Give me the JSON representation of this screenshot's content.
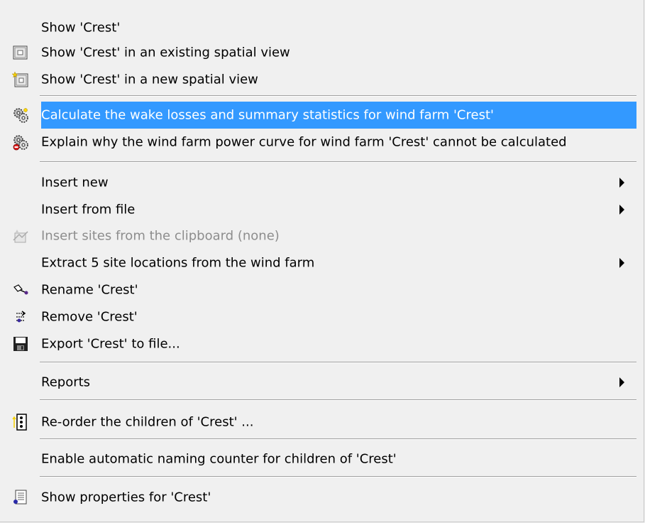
{
  "menu": {
    "items": [
      {
        "label": "Show 'Crest'"
      },
      {
        "label": "Show 'Crest' in an existing spatial view",
        "icon": "spatial-view-icon"
      },
      {
        "label": "Show 'Crest' in a new spatial view",
        "icon": "new-spatial-view-icon"
      },
      {
        "label": "Calculate the wake losses and summary statistics for wind farm 'Crest'",
        "icon": "calculate-gears-icon",
        "highlighted": true
      },
      {
        "label": "Explain why the wind farm power curve for wind farm 'Crest' cannot be calculated",
        "icon": "explain-gears-icon"
      },
      {
        "label": "Insert new",
        "submenu": true
      },
      {
        "label": "Insert from file",
        "submenu": true
      },
      {
        "label": "Insert sites from the clipboard (none)",
        "icon": "clipboard-sites-icon",
        "disabled": true
      },
      {
        "label": "Extract 5 site locations from the wind farm",
        "submenu": true
      },
      {
        "label": "Rename 'Crest'",
        "icon": "rename-icon"
      },
      {
        "label": "Remove 'Crest'",
        "icon": "remove-icon"
      },
      {
        "label": "Export 'Crest' to file...",
        "icon": "export-disk-icon"
      },
      {
        "label": "Reports",
        "submenu": true
      },
      {
        "label": "Re-order the children of 'Crest' ...",
        "icon": "reorder-icon"
      },
      {
        "label": "Enable automatic naming counter for children of 'Crest'"
      },
      {
        "label": "Show properties for 'Crest'",
        "icon": "properties-icon"
      }
    ]
  },
  "colors": {
    "highlight": "#3399ff",
    "menu_bg": "#f0f0f0",
    "disabled_text": "#8d8d8d"
  }
}
